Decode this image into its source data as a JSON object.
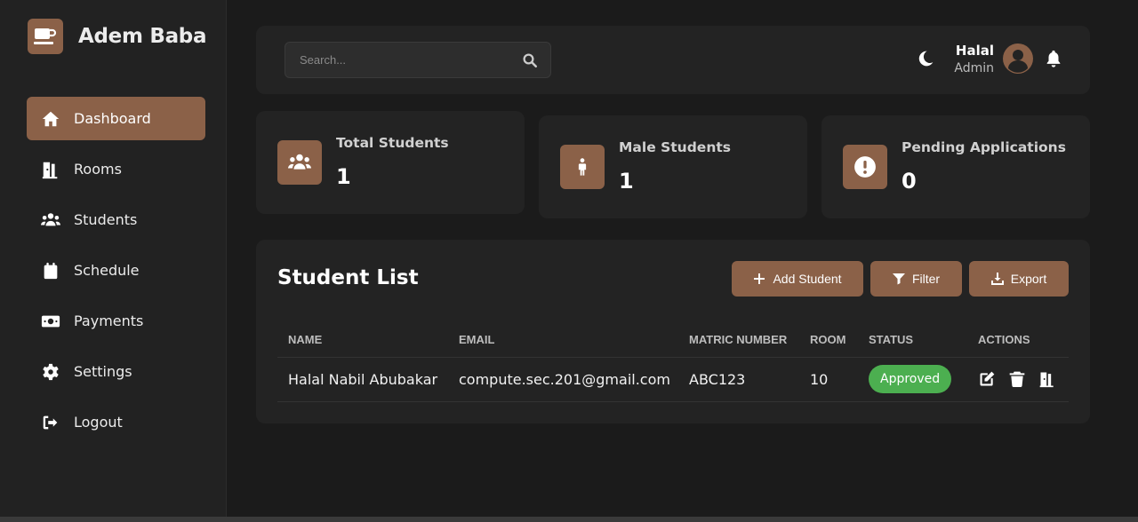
{
  "sidebar": {
    "brand": {
      "name": "Adem Baba",
      "icon": "coffee-cup-icon"
    },
    "items": [
      {
        "label": "Dashboard",
        "icon": "home-icon",
        "active": true
      },
      {
        "label": "Rooms",
        "icon": "door-icon",
        "active": false
      },
      {
        "label": "Students",
        "icon": "users-icon",
        "active": false
      },
      {
        "label": "Schedule",
        "icon": "calendar-icon",
        "active": false
      },
      {
        "label": "Payments",
        "icon": "money-icon",
        "active": false
      },
      {
        "label": "Settings",
        "icon": "gear-icon",
        "active": false
      },
      {
        "label": "Logout",
        "icon": "logout-icon",
        "active": false
      }
    ]
  },
  "header": {
    "search": {
      "placeholder": "Search...",
      "value": ""
    },
    "user": {
      "name": "Halal",
      "role": "Admin"
    }
  },
  "stats": [
    {
      "label": "Total Students",
      "value": "1",
      "icon": "users-icon"
    },
    {
      "label": "Male Students",
      "value": "1",
      "icon": "male-icon"
    },
    {
      "label": "Pending Applications",
      "value": "0",
      "icon": "exclamation-icon"
    }
  ],
  "student_list": {
    "title": "Student List",
    "buttons": {
      "add": "Add Student",
      "filter": "Filter",
      "export": "Export"
    },
    "columns": [
      "NAME",
      "EMAIL",
      "MATRIC NUMBER",
      "ROOM",
      "STATUS",
      "ACTIONS"
    ],
    "rows": [
      {
        "name": "Halal Nabil Abubakar",
        "email": "compute.sec.201@gmail.com",
        "matric": "ABC123",
        "room": "10",
        "status": "Approved"
      }
    ]
  },
  "colors": {
    "accent": "#8b6148",
    "background": "#1b1b1b",
    "card": "#232323",
    "approved": "#4caf50"
  }
}
